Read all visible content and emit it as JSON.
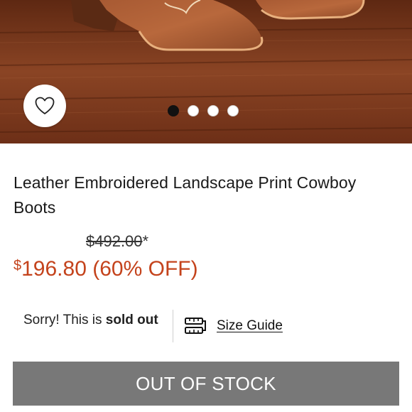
{
  "product": {
    "title": "Leather Embroidered Landscape Print Cowboy Boots",
    "original_price": "$492.00",
    "original_price_asterisk": "*",
    "sale_currency": "$",
    "sale_amount": "196.80",
    "discount_label": "(60% OFF)",
    "sale_color": "#c4431c"
  },
  "gallery": {
    "image_count": 4,
    "active_index": 0,
    "favorite_icon": "heart-outline-icon"
  },
  "availability": {
    "prefix": "Sorry! This is ",
    "status": "sold out"
  },
  "size_guide": {
    "label": "Size Guide",
    "icon": "ruler-icon"
  },
  "cta": {
    "label": "OUT OF STOCK",
    "background": "#787878"
  }
}
